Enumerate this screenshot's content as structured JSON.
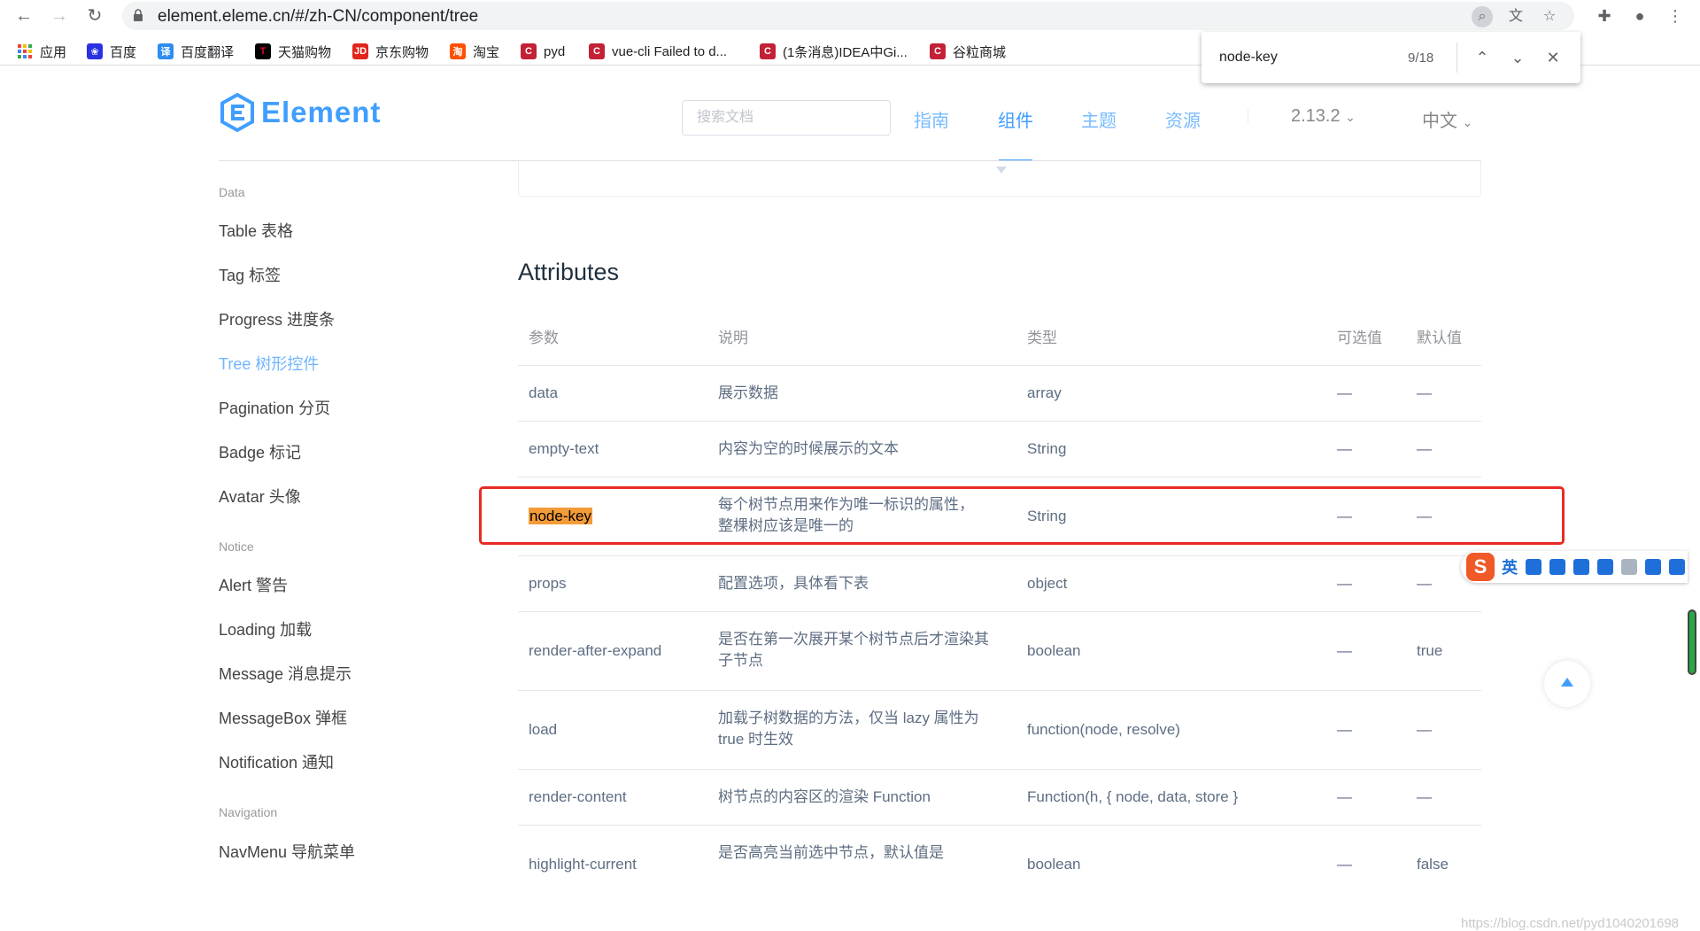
{
  "browser": {
    "url": "element.eleme.cn/#/zh-CN/component/tree",
    "bookmarks": [
      {
        "label": "应用",
        "icon": "apps-icon"
      },
      {
        "label": "百度",
        "icon": "baidu-icon"
      },
      {
        "label": "百度翻译",
        "icon": "baidu-translate-icon"
      },
      {
        "label": "天猫购物",
        "icon": "tmall-icon"
      },
      {
        "label": "京东购物",
        "icon": "jd-icon"
      },
      {
        "label": "淘宝",
        "icon": "taobao-icon"
      },
      {
        "label": "pyd",
        "icon": "csdn-icon"
      },
      {
        "label": "vue-cli Failed to d...",
        "icon": "csdn-icon"
      },
      {
        "label": "(1条消息)IDEA中Gi...",
        "icon": "csdn-icon"
      },
      {
        "label": "谷粒商城",
        "icon": "csdn-icon"
      }
    ],
    "find": {
      "query": "node-key",
      "count": "9/18"
    }
  },
  "site": {
    "logo_text": "Element",
    "search_placeholder": "搜索文档",
    "nav": [
      {
        "label": "指南",
        "active": false
      },
      {
        "label": "组件",
        "active": true
      },
      {
        "label": "主题",
        "active": false
      },
      {
        "label": "资源",
        "active": false
      }
    ],
    "version": "2.13.2",
    "language": "中文"
  },
  "sidebar": {
    "groups": [
      {
        "title": "Data",
        "items": [
          "Table 表格",
          "Tag 标签",
          "Progress 进度条",
          "Tree 树形控件",
          "Pagination 分页",
          "Badge 标记",
          "Avatar 头像"
        ]
      },
      {
        "title": "Notice",
        "items": [
          "Alert 警告",
          "Loading 加载",
          "Message 消息提示",
          "MessageBox 弹框",
          "Notification 通知"
        ]
      },
      {
        "title": "Navigation",
        "items": [
          "NavMenu 导航菜单"
        ]
      }
    ],
    "active_item": "Tree 树形控件"
  },
  "content": {
    "section_title": "Attributes",
    "columns": [
      "参数",
      "说明",
      "类型",
      "可选值",
      "默认值"
    ],
    "rows": [
      {
        "param": "data",
        "desc": "展示数据",
        "type": "array",
        "options": "—",
        "default": "—"
      },
      {
        "param": "empty-text",
        "desc": "内容为空的时候展示的文本",
        "type": "String",
        "options": "—",
        "default": "—"
      },
      {
        "param": "node-key",
        "desc": "每个树节点用来作为唯一标识的属性，整棵树应该是唯一的",
        "type": "String",
        "options": "—",
        "default": "—"
      },
      {
        "param": "props",
        "desc": "配置选项，具体看下表",
        "type": "object",
        "options": "—",
        "default": "—"
      },
      {
        "param": "render-after-expand",
        "desc": "是否在第一次展开某个树节点后才渲染其子节点",
        "type": "boolean",
        "options": "—",
        "default": "true"
      },
      {
        "param": "load",
        "desc": "加载子树数据的方法，仅当 lazy 属性为true 时生效",
        "type": "function(node, resolve)",
        "options": "—",
        "default": "—"
      },
      {
        "param": "render-content",
        "desc": "树节点的内容区的渲染 Function",
        "type": "Function(h, { node, data, store }",
        "options": "—",
        "default": "—"
      },
      {
        "param": "highlight-current",
        "desc": "是否高亮当前选中节点，默认值是",
        "type": "boolean",
        "options": "—",
        "default": "false"
      }
    ]
  },
  "ime": {
    "mode": "英"
  },
  "watermark": "https://blog.csdn.net/pyd1040201698",
  "colors": {
    "accent": "#409eff",
    "highlight": "#f39c37",
    "annotation": "#ea2a24"
  }
}
